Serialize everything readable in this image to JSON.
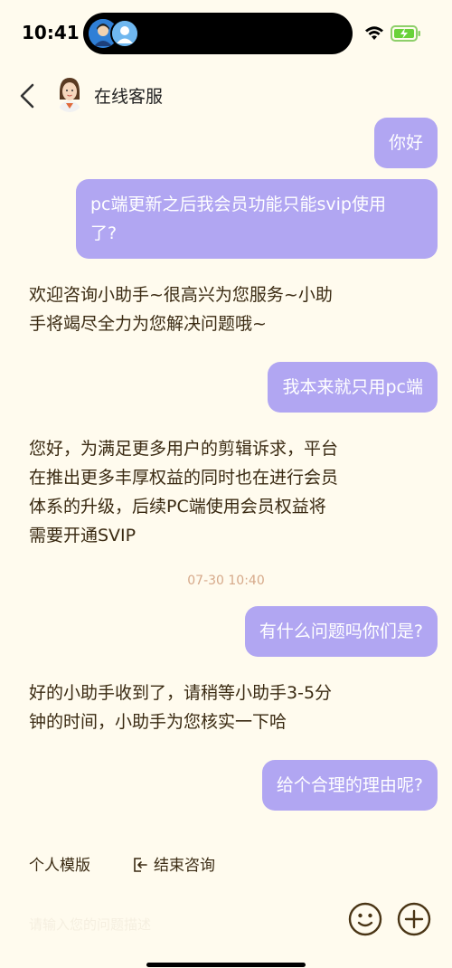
{
  "status_bar": {
    "time": "10:41"
  },
  "header": {
    "title": "在线客服"
  },
  "messages": {
    "m1": "你好",
    "m2_line1": "pc端更新之后我会员功能只能svip使用",
    "m2_line2": "了?",
    "m3_line1": "欢迎咨询小助手~很高兴为您服务~小助",
    "m3_line2": "手将竭尽全力为您解决问题哦~",
    "m4": "我本来就只用pc端",
    "m5_line1": "您好，为满足更多用户的剪辑诉求，平台",
    "m5_line2": "在推出更多丰厚权益的同时也在进行会员",
    "m5_line3": "体系的升级，后续PC端使用会员权益将",
    "m5_line4": "需要开通SVIP",
    "timestamp": "07-30 10:40",
    "m6": "有什么问题吗你们是?",
    "m7_line1": "好的小助手收到了，请稍等小助手3-5分",
    "m7_line2": "钟的时间，小助手为您核实一下哈",
    "m8": "给个合理的理由呢?"
  },
  "actions": {
    "personal_template": "个人模版",
    "end_consultation": "结束咨询"
  },
  "input": {
    "placeholder": "请输入您的问题描述"
  },
  "icons": [
    "back-icon",
    "agent-avatar",
    "logout-icon",
    "emoji-icon",
    "plus-icon",
    "wifi-icon",
    "battery-icon"
  ],
  "colors": {
    "background": "#FFFBEE",
    "outgoing_bubble": "#B1A6F2",
    "text": "#3a2a12",
    "timestamp": "#d6a98a"
  }
}
